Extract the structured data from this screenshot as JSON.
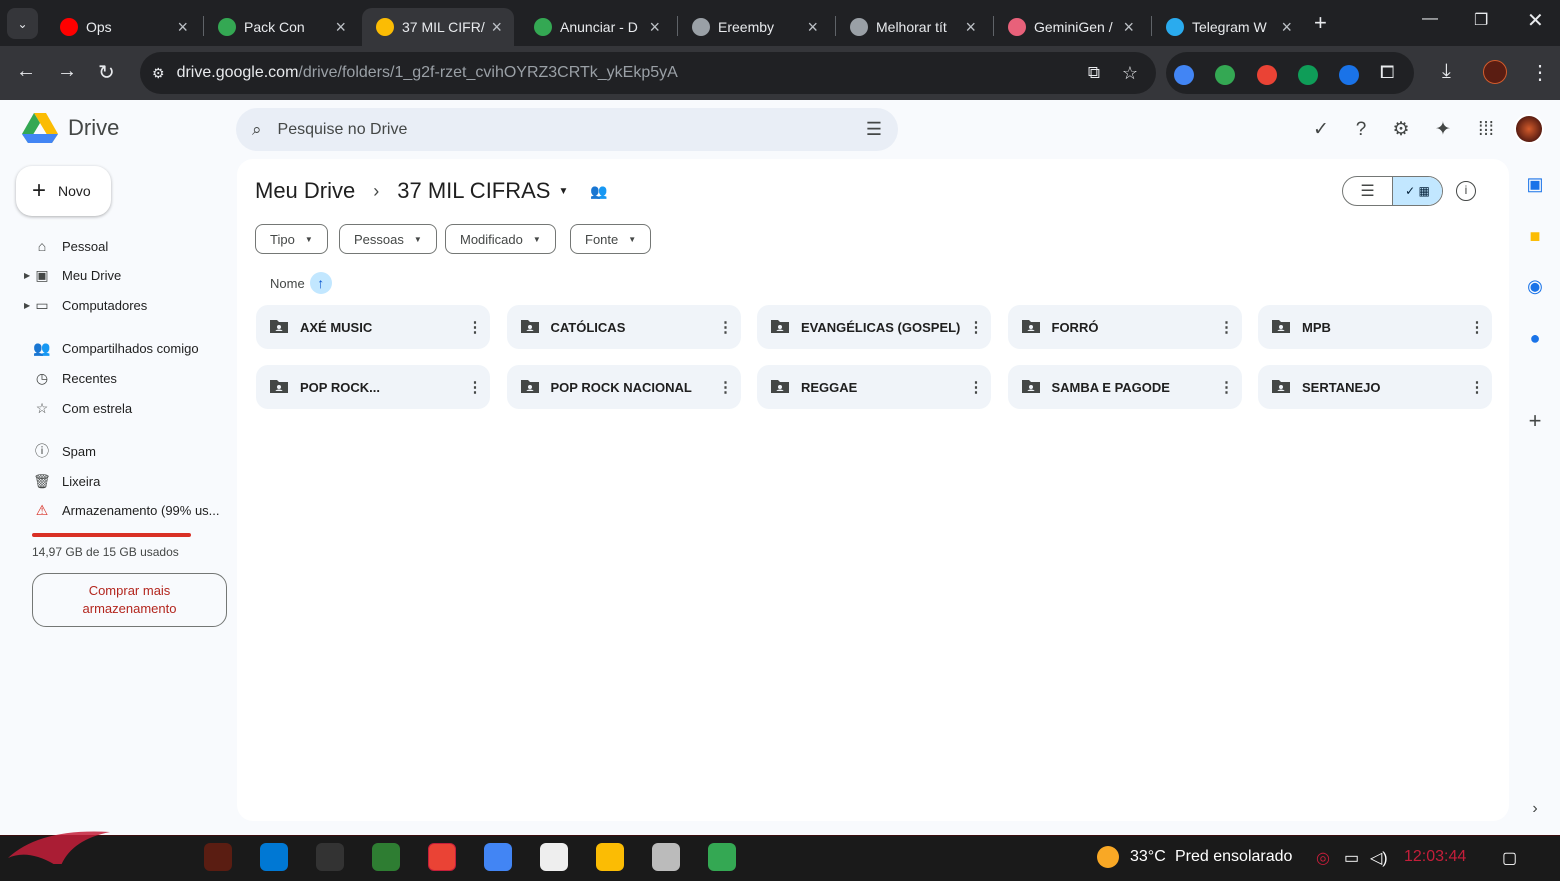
{
  "browser": {
    "tabs": [
      {
        "title": "Ops",
        "fav": "youtube-icon",
        "color": "#ff0000"
      },
      {
        "title": "Pack Con",
        "fav": "pack-icon",
        "color": "#34a853"
      },
      {
        "title": "37 MIL CIFR/",
        "fav": "drive-icon",
        "color": "#fbbc04"
      },
      {
        "title": "Anunciar - D",
        "fav": "globe-icon",
        "color": "#34a853"
      },
      {
        "title": "Ereemby",
        "fav": "globe-icon",
        "color": "#9aa0a6"
      },
      {
        "title": "Melhorar tít",
        "fav": "openai-icon",
        "color": "#9aa0a6"
      },
      {
        "title": "GeminiGen /",
        "fav": "gemini-icon",
        "color": "#e8617a"
      },
      {
        "title": "Telegram W",
        "fav": "telegram-icon",
        "color": "#2aabee"
      }
    ],
    "url_host": "drive.google.com",
    "url_path": "/drive/folders/1_g2f-rzet_cvihOYRZ3CRTk_ykEkp5yA"
  },
  "drive": {
    "app_name": "Drive",
    "search_placeholder": "Pesquise no Drive",
    "new_label": "Novo",
    "nav": [
      {
        "label": "Pessoal",
        "icon": "home-icon"
      },
      {
        "label": "Meu Drive",
        "icon": "my-drive-icon"
      },
      {
        "label": "Computadores",
        "icon": "computer-icon"
      },
      {
        "label": "Compartilhados comigo",
        "icon": "people-icon"
      },
      {
        "label": "Recentes",
        "icon": "clock-icon"
      },
      {
        "label": "Com estrela",
        "icon": "star-icon"
      },
      {
        "label": "Spam",
        "icon": "spam-icon"
      },
      {
        "label": "Lixeira",
        "icon": "trash-icon"
      },
      {
        "label": "Armazenamento (99% us...",
        "icon": "warning-icon"
      }
    ],
    "storage_text": "14,97 GB de 15 GB usados",
    "storage_fraction": 0.998,
    "buy_line1": "Comprar mais",
    "buy_line2": "armazenamento",
    "breadcrumb_root": "Meu Drive",
    "breadcrumb_current": "37 MIL CIFRAS",
    "filters": [
      "Tipo",
      "Pessoas",
      "Modificado",
      "Fonte"
    ],
    "sort_label": "Nome",
    "folders": [
      "AXÉ MUSIC",
      "CATÓLICAS",
      "EVANGÉLICAS (GOSPEL)",
      "FORRÓ",
      "MPB",
      "POP ROCK...",
      "POP ROCK NACIONAL",
      "REGGAE",
      "SAMBA E PAGODE",
      "SERTANEJO"
    ]
  },
  "taskbar": {
    "temperature": "33°C",
    "weather": "Pred ensolarado",
    "time": "12:03:44"
  }
}
